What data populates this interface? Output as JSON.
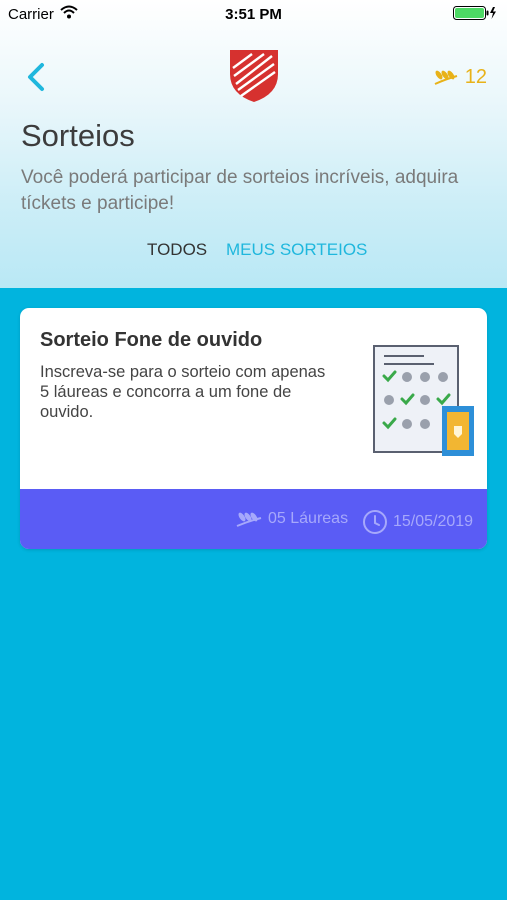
{
  "status_bar": {
    "carrier": "Carrier",
    "time": "3:51 PM"
  },
  "nav": {
    "laurel_count": "12"
  },
  "page": {
    "title": "Sorteios",
    "subtitle": "Você poderá participar de sorteios incríveis, adquira tíckets e participe!"
  },
  "tabs": [
    {
      "label": "TODOS",
      "active": false
    },
    {
      "label": "MEUS SORTEIOS",
      "active": true
    }
  ],
  "cards": [
    {
      "title": "Sorteio Fone de ouvido",
      "description": "Inscreva-se para o sorteio com apenas 5 láureas e concorra a um fone de ouvido.",
      "laureas": "05 Láureas",
      "date": "15/05/2019"
    }
  ],
  "colors": {
    "accent": "#1fb7dd",
    "background": "#01b4de",
    "card_footer": "#5a5cf5",
    "laurel": "#e8b219",
    "logo_red": "#d6312f"
  },
  "icons": {
    "back": "chevron-left-icon",
    "laurel": "laurel-icon",
    "clock": "clock-icon"
  }
}
